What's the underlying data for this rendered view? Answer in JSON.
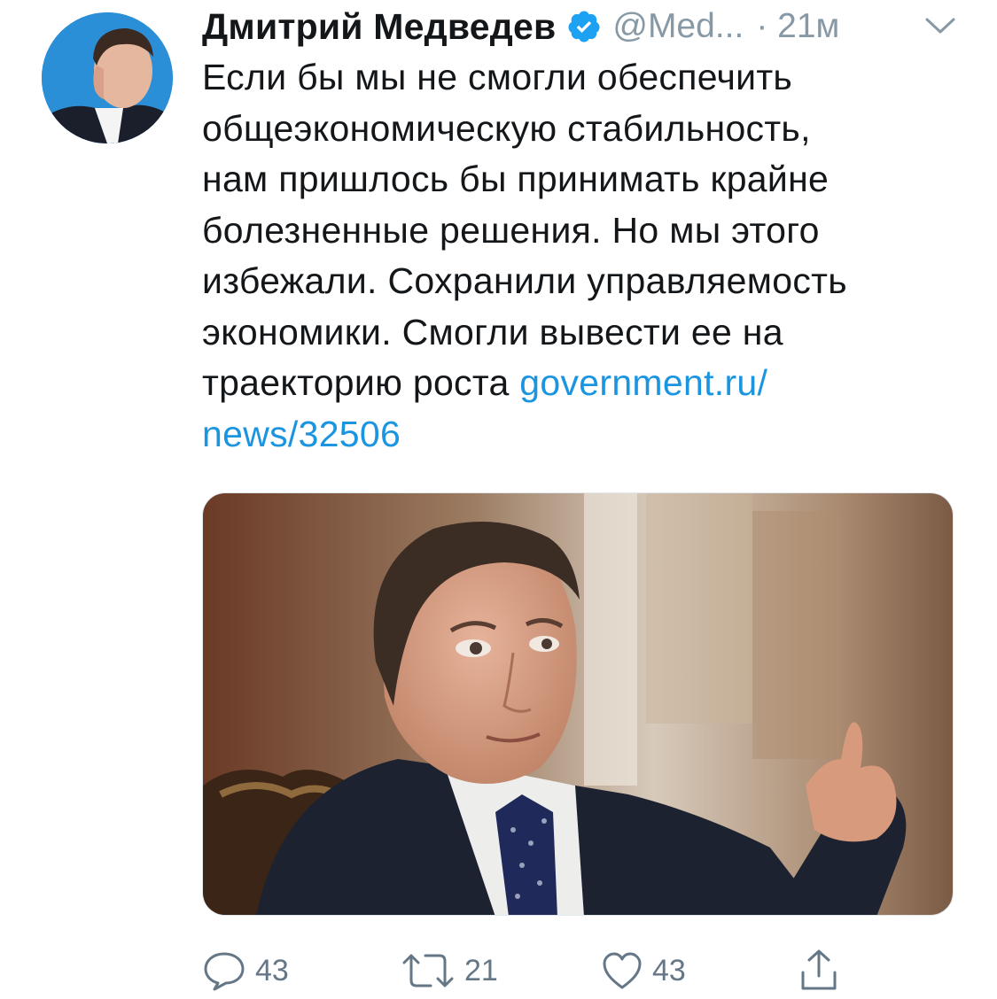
{
  "tweet": {
    "author": {
      "display_name": "Дмитрий Медведев",
      "handle": "@Med...",
      "verified": true
    },
    "separator": "·",
    "time": "21м",
    "text_lines": [
      "Если бы мы не смогли обеспечить",
      "общеэкономическую стабильность,",
      "нам пришлось бы принимать крайне",
      "болезненные решения. Но мы этого",
      "избежали. Сохранили управляемость",
      "экономики. Смогли вывести ее на",
      "траекторию роста "
    ],
    "link_part1": "government.ru/",
    "link_part2": "news/32506"
  },
  "actions": {
    "reply_count": "43",
    "retweet_count": "21",
    "like_count": "43"
  },
  "icons": {
    "verified": "verified-badge-icon",
    "caret": "chevron-down-icon",
    "reply": "reply-icon",
    "retweet": "retweet-icon",
    "like": "heart-icon",
    "share": "share-icon"
  },
  "colors": {
    "accent": "#1b95e0",
    "text": "#14171a",
    "muted": "#8899a6"
  }
}
